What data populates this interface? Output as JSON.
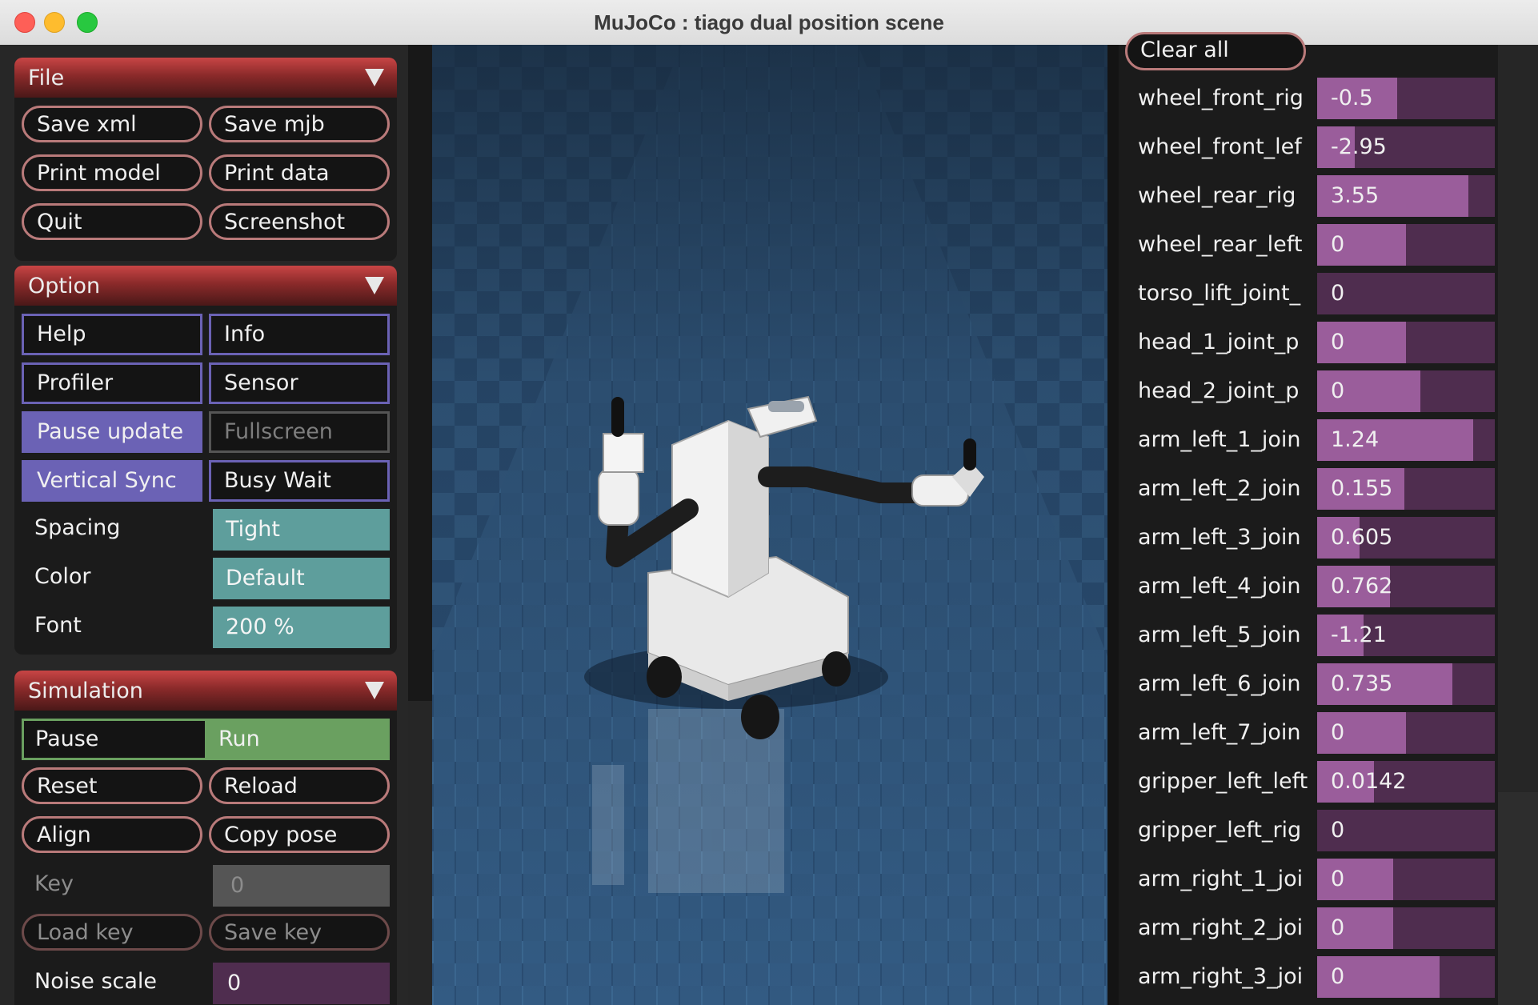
{
  "window": {
    "title": "MuJoCo : tiago dual position scene"
  },
  "file": {
    "title": "File",
    "save_xml": "Save xml",
    "save_mjb": "Save mjb",
    "print_model": "Print model",
    "print_data": "Print data",
    "quit": "Quit",
    "screenshot": "Screenshot"
  },
  "option": {
    "title": "Option",
    "help": "Help",
    "info": "Info",
    "profiler": "Profiler",
    "sensor": "Sensor",
    "pause_update": "Pause update",
    "fullscreen": "Fullscreen",
    "vertical_sync": "Vertical Sync",
    "busy_wait": "Busy Wait",
    "spacing_label": "Spacing",
    "spacing_value": "Tight",
    "color_label": "Color",
    "color_value": "Default",
    "font_label": "Font",
    "font_value": "200 %"
  },
  "simulation": {
    "title": "Simulation",
    "pause": "Pause",
    "run": "Run",
    "reset": "Reset",
    "reload": "Reload",
    "align": "Align",
    "copy_pose": "Copy pose",
    "key_label": "Key",
    "key_value": "0",
    "load_key": "Load key",
    "save_key": "Save key",
    "noise_label": "Noise scale",
    "noise_value": "0"
  },
  "control": {
    "clear_all": "Clear all",
    "joints": [
      {
        "name": "wheel_front_rig",
        "value": "-0.5",
        "fill": 0.45
      },
      {
        "name": "wheel_front_lef",
        "value": "-2.95",
        "fill": 0.21
      },
      {
        "name": "wheel_rear_rig",
        "value": "3.55",
        "fill": 0.85
      },
      {
        "name": "wheel_rear_left",
        "value": "0",
        "fill": 0.5
      },
      {
        "name": "torso_lift_joint_",
        "value": "0",
        "fill": 0.0
      },
      {
        "name": "head_1_joint_p",
        "value": "0",
        "fill": 0.5
      },
      {
        "name": "head_2_joint_p",
        "value": "0",
        "fill": 0.58
      },
      {
        "name": "arm_left_1_join",
        "value": "1.24",
        "fill": 0.88
      },
      {
        "name": "arm_left_2_join",
        "value": "0.155",
        "fill": 0.49
      },
      {
        "name": "arm_left_3_join",
        "value": "0.605",
        "fill": 0.24
      },
      {
        "name": "arm_left_4_join",
        "value": "0.762",
        "fill": 0.41
      },
      {
        "name": "arm_left_5_join",
        "value": "-1.21",
        "fill": 0.26
      },
      {
        "name": "arm_left_6_join",
        "value": "0.735",
        "fill": 0.76
      },
      {
        "name": "arm_left_7_join",
        "value": "0",
        "fill": 0.5
      },
      {
        "name": "gripper_left_left",
        "value": "0.0142",
        "fill": 0.32
      },
      {
        "name": "gripper_left_rig",
        "value": "0",
        "fill": 0.0
      },
      {
        "name": "arm_right_1_joi",
        "value": "0",
        "fill": 0.43
      },
      {
        "name": "arm_right_2_joi",
        "value": "0",
        "fill": 0.43
      },
      {
        "name": "arm_right_3_joi",
        "value": "0",
        "fill": 0.69
      }
    ]
  }
}
